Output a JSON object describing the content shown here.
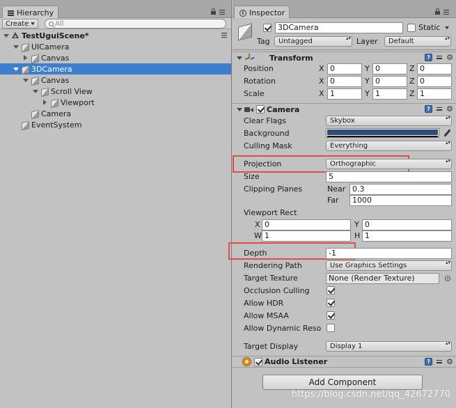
{
  "hierarchy": {
    "tab_label": "Hierarchy",
    "create_label": "Create",
    "search_placeholder": "All",
    "scene_name": "TestUguiScene*",
    "rows": [
      {
        "label": "UICamera",
        "depth": 1,
        "fold": "open",
        "selected": false
      },
      {
        "label": "Canvas",
        "depth": 2,
        "fold": "closed",
        "selected": false
      },
      {
        "label": "3DCamera",
        "depth": 1,
        "fold": "open",
        "selected": true
      },
      {
        "label": "Canvas",
        "depth": 2,
        "fold": "open",
        "selected": false
      },
      {
        "label": "Scroll View",
        "depth": 3,
        "fold": "open",
        "selected": false
      },
      {
        "label": "Viewport",
        "depth": 4,
        "fold": "closed",
        "selected": false
      },
      {
        "label": "Camera",
        "depth": 2,
        "fold": "none",
        "selected": false
      },
      {
        "label": "EventSystem",
        "depth": 1,
        "fold": "none",
        "selected": false
      }
    ]
  },
  "inspector": {
    "tab_label": "Inspector",
    "object_name": "3DCamera",
    "static_label": "Static",
    "tag_label": "Tag",
    "tag_value": "Untagged",
    "layer_label": "Layer",
    "layer_value": "Default",
    "transform": {
      "title": "Transform",
      "position_label": "Position",
      "rotation_label": "Rotation",
      "scale_label": "Scale",
      "position": {
        "x": "0",
        "y": "0",
        "z": "0"
      },
      "rotation": {
        "x": "0",
        "y": "0",
        "z": "0"
      },
      "scale": {
        "x": "1",
        "y": "1",
        "z": "1"
      }
    },
    "axis": {
      "x": "X",
      "y": "Y",
      "z": "Z",
      "w": "W",
      "h": "H"
    },
    "camera": {
      "title": "Camera",
      "clear_flags_label": "Clear Flags",
      "clear_flags": "Skybox",
      "background_label": "Background",
      "background_color": "#314d79",
      "culling_mask_label": "Culling Mask",
      "culling_mask": "Everything",
      "projection_label": "Projection",
      "projection": "Orthographic",
      "size_label": "Size",
      "size": "5",
      "clipping_label": "Clipping Planes",
      "near_label": "Near",
      "near": "0.3",
      "far_label": "Far",
      "far": "1000",
      "viewport_label": "Viewport Rect",
      "viewport": {
        "x": "0",
        "y": "0",
        "w": "1",
        "h": "1"
      },
      "depth_label": "Depth",
      "depth": "-1",
      "rendering_path_label": "Rendering Path",
      "rendering_path": "Use Graphics Settings",
      "target_texture_label": "Target Texture",
      "target_texture": "None (Render Texture)",
      "occlusion_label": "Occlusion Culling",
      "occlusion": true,
      "hdr_label": "Allow HDR",
      "hdr": true,
      "msaa_label": "Allow MSAA",
      "msaa": true,
      "dynamic_label": "Allow Dynamic Reso",
      "dynamic": false,
      "target_display_label": "Target Display",
      "target_display": "Display 1"
    },
    "audio_listener": {
      "title": "Audio Listener"
    },
    "add_component_label": "Add Component"
  },
  "watermark": "https://blog.csdn.net/qq_42672770",
  "colors": {
    "selection": "#3e7ecf",
    "highlight_box": "#e04b4b",
    "panel": "#c2c2c2"
  }
}
